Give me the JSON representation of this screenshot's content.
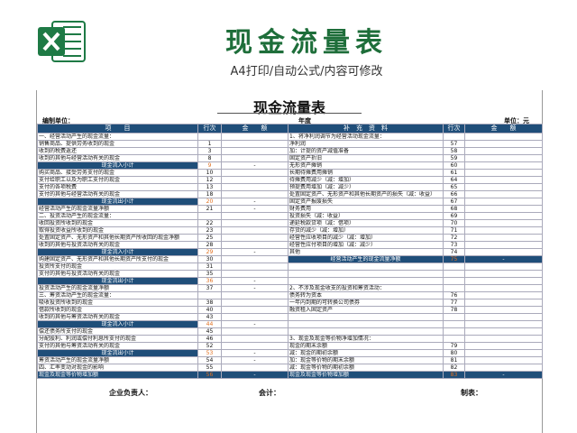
{
  "banner": {
    "title": "现金流量表",
    "subtitle": "A4打印/自动公式/内容可修改"
  },
  "sheet": {
    "title": "现金流量表",
    "unit_label": "编制单位：",
    "year_label": "年度",
    "money_unit": "单位：元"
  },
  "headers": {
    "item": "项　　目",
    "line": "行次",
    "amount": "金　　额",
    "supp": "补　充　资　料",
    "line2": "行次",
    "amount2": "金　　额"
  },
  "rows": [
    {
      "l": "一、经营活动产生的现金流量：",
      "n": "",
      "a": "",
      "r": "1、将净利润调节为经营活动现金流量：",
      "rn": "",
      "ra": ""
    },
    {
      "l": "销售商品、提供劳务收到的现金",
      "n": "1",
      "a": "",
      "r": "净利润",
      "rn": "57",
      "ra": ""
    },
    {
      "l": "收到的税费返还",
      "n": "3",
      "a": "",
      "r": "加：计提的资产减值准备",
      "rn": "58",
      "ra": ""
    },
    {
      "l": "收到的其他与经营活动有关的现金",
      "n": "8",
      "a": "",
      "r": "固定资产折旧",
      "rn": "59",
      "ra": ""
    },
    {
      "l": "现金流入小计",
      "n": "9",
      "a": "-",
      "r": "无形资产摊销",
      "rn": "60",
      "ra": "",
      "sub": true
    },
    {
      "l": "购买商品、接受劳务支付的现金",
      "n": "10",
      "a": "",
      "r": "长期待摊费用摊销",
      "rn": "61",
      "ra": ""
    },
    {
      "l": "支付给职工以及为职工支付的现金",
      "n": "12",
      "a": "",
      "r": "待摊费用减少（减：增加）",
      "rn": "64",
      "ra": ""
    },
    {
      "l": "支付的各项税费",
      "n": "13",
      "a": "",
      "r": "预提费用增加（减：减少）",
      "rn": "65",
      "ra": ""
    },
    {
      "l": "支付的其他与经营活动有关的现金",
      "n": "18",
      "a": "",
      "r": "处置固定资产、无形资产和其他长期资产的损失（减：收益）",
      "rn": "66",
      "ra": ""
    },
    {
      "l": "现金流出小计",
      "n": "20",
      "a": "-",
      "r": "固定资产报废损失",
      "rn": "67",
      "ra": "",
      "sub": true
    },
    {
      "l": "经营活动产生的现金流量净额",
      "n": "21",
      "a": "-",
      "r": "财务费用",
      "rn": "68",
      "ra": ""
    },
    {
      "l": "二、投资活动产生的现金流量：",
      "n": "",
      "a": "",
      "r": "投资损失（减：收益）",
      "rn": "69",
      "ra": ""
    },
    {
      "l": "收回投资所收到的现金",
      "n": "22",
      "a": "",
      "r": "递延税款贷项（减：借项）",
      "rn": "70",
      "ra": ""
    },
    {
      "l": "取得投资收益所收到的现金",
      "n": "23",
      "a": "",
      "r": "存货的减少（减：增加）",
      "rn": "71",
      "ra": ""
    },
    {
      "l": "处置固定资产、无形资产和其他长期资产所收回的现金净额",
      "n": "25",
      "a": "",
      "r": "经营性应收项目的减少（减：增加）",
      "rn": "72",
      "ra": ""
    },
    {
      "l": "收到的其他与投资活动有关的现金",
      "n": "28",
      "a": "",
      "r": "经营性应付项目的增加（减：减少）",
      "rn": "73",
      "ra": ""
    },
    {
      "l": "现金流入小计",
      "n": "29",
      "a": "-",
      "r": "其他",
      "rn": "74",
      "ra": "",
      "sub": true
    },
    {
      "l": "购建固定资产、无形资产和其他长期资产所支付的现金",
      "n": "30",
      "a": "",
      "r": "经营活动产生的现金流量净额",
      "rn": "75",
      "ra": "-",
      "rhl": true
    },
    {
      "l": "投资所支付的现金",
      "n": "31",
      "a": "",
      "r": "",
      "rn": "",
      "ra": ""
    },
    {
      "l": "支付的其他与投资活动有关的现金",
      "n": "35",
      "a": "",
      "r": "",
      "rn": "",
      "ra": ""
    },
    {
      "l": "现金流出小计",
      "n": "36",
      "a": "-",
      "r": "",
      "rn": "",
      "ra": "",
      "sub": true
    },
    {
      "l": "投资活动产生的现金流量净额",
      "n": "37",
      "a": "-",
      "r": "2、不涉及现金收支的投资和筹资活动：",
      "rn": "",
      "ra": ""
    },
    {
      "l": "三、筹资活动产生的现金流量：",
      "n": "",
      "a": "",
      "r": "债务转为资本",
      "rn": "76",
      "ra": ""
    },
    {
      "l": "吸收投资所收到的现金",
      "n": "38",
      "a": "",
      "r": "一年内到期的可转换公司债券",
      "rn": "77",
      "ra": ""
    },
    {
      "l": "借款所收到的现金",
      "n": "40",
      "a": "",
      "r": "融资租入固定资产",
      "rn": "78",
      "ra": ""
    },
    {
      "l": "收到的其他与筹资活动有关的现金",
      "n": "43",
      "a": "",
      "r": "",
      "rn": "",
      "ra": ""
    },
    {
      "l": "现金流入小计",
      "n": "44",
      "a": "-",
      "r": "",
      "rn": "",
      "ra": "",
      "sub": true
    },
    {
      "l": "偿还债务所支付的现金",
      "n": "45",
      "a": "",
      "r": "",
      "rn": "",
      "ra": ""
    },
    {
      "l": "分配股利、利润或偿付利息所支付的现金",
      "n": "46",
      "a": "",
      "r": "3、现金及现金等价物净增加情况：",
      "rn": "",
      "ra": ""
    },
    {
      "l": "支付的其他与筹资活动有关的现金",
      "n": "52",
      "a": "",
      "r": "现金的期末余额",
      "rn": "79",
      "ra": ""
    },
    {
      "l": "现金流出小计",
      "n": "53",
      "a": "-",
      "r": "减：现金的期初余额",
      "rn": "80",
      "ra": "",
      "sub": true
    },
    {
      "l": "筹资活动产生的现金流量净额",
      "n": "54",
      "a": "-",
      "r": "加：现金等价物的期末余额",
      "rn": "81",
      "ra": ""
    },
    {
      "l": "四、汇率变动对现金的影响",
      "n": "55",
      "a": "",
      "r": "减：现金等价物的期初余额",
      "rn": "82",
      "ra": ""
    }
  ],
  "total": {
    "l": "现金及现金等价物增加额",
    "n": "56",
    "a": "-",
    "r": "现金及现金等价物增加额",
    "rn": "83",
    "ra": "-"
  },
  "footer": {
    "manager": "企业负责人：",
    "accountant": "会计：",
    "preparer": "制表："
  }
}
